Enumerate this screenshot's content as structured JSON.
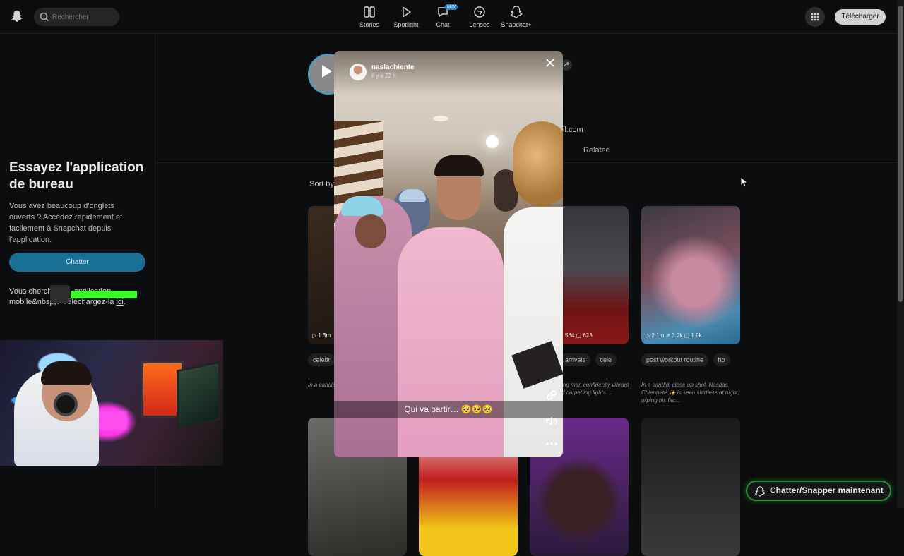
{
  "header": {
    "search_placeholder": "Rechercher",
    "nav": [
      {
        "label": "Stories",
        "icon": "stories-icon"
      },
      {
        "label": "Spotlight",
        "icon": "spotlight-play-icon"
      },
      {
        "label": "Chat",
        "icon": "chat-icon",
        "badge": "NEW"
      },
      {
        "label": "Lenses",
        "icon": "lenses-icon"
      },
      {
        "label": "Snapchat+",
        "icon": "snapchat-plus-icon"
      }
    ],
    "download_label": "Télécharger"
  },
  "sidebar": {
    "title": "Essayez l'application de bureau",
    "description": "Vous avez beaucoup d'onglets ouverts ? Accédez rapidement et facilement à Snapchat depuis l'application.",
    "chat_button": "Chatter",
    "mobile_prefix": "Vous cherch",
    "mobile_mid": "application",
    "mobile_line2": "mobile&nbsp;?",
    "mobile_download": "Téléchargez-la",
    "mobile_link": "ici",
    "mobile_end": "."
  },
  "profile": {
    "email_fragment": "il.com",
    "related_tab": "Related",
    "sort_label": "Sort by"
  },
  "cards_row1": [
    {
      "stats": "▷ 1.3m"
    },
    {
      "stats": "564  ▢ 623"
    },
    {
      "stats": "▷ 2.1m  ⇗ 3.2k  ▢ 1.9k"
    }
  ],
  "chips": {
    "row1a": [
      "celebr"
    ],
    "row1b": [
      "t arrivals",
      "cele"
    ],
    "row1c": [
      "post workout routine",
      "ho"
    ]
  },
  "captions": [
    "In a candid... Nasdas C... a victory v...",
    "oung man confidently vibrant red carpet ing lights....",
    "In a candid, close-up shot, Nasdas Chienneté ✨ is seen shirtless at night, wiping his fac..."
  ],
  "story": {
    "username": "naslachiente",
    "time": "Il y a 22 h",
    "caption": "Qui va partir… 🥺🥺🥺"
  },
  "fab_label": "Chatter/Snapper maintenant"
}
